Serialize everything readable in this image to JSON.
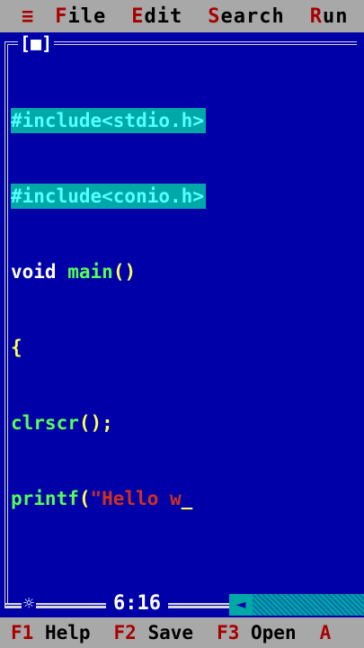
{
  "menu": {
    "system_icon": "≡",
    "items": [
      {
        "hot": "F",
        "rest": "ile"
      },
      {
        "hot": "E",
        "rest": "dit"
      },
      {
        "hot": "S",
        "rest": "earch"
      },
      {
        "hot": "R",
        "rest": "un"
      }
    ]
  },
  "window": {
    "close_box": "[■]",
    "code_lines": [
      {
        "text": "#include<stdio.h>"
      },
      {
        "text": "#include<conio.h>"
      },
      {
        "kw": "void",
        "sp": " ",
        "fn": "main",
        "pn": "()"
      },
      {
        "pn": "{"
      },
      {
        "fn": "clrscr",
        "pn": "();"
      },
      {
        "fn": "printf",
        "pn": "(",
        "str": "\"Hello w",
        "cursor": "_"
      }
    ],
    "status_icon": "☼",
    "cursor_position": "6:16",
    "scroll_arrow": "◄"
  },
  "function_keys": [
    {
      "key": "F1",
      "label": "Help"
    },
    {
      "key": "F2",
      "label": "Save"
    },
    {
      "key": "F3",
      "label": "Open"
    },
    {
      "key": "A",
      "label": ""
    }
  ],
  "colors": {
    "editor_bg": "#0000a8",
    "menu_bg": "#a8a8a8",
    "hotkey": "#a80000",
    "highlight": "#00a8a8"
  }
}
